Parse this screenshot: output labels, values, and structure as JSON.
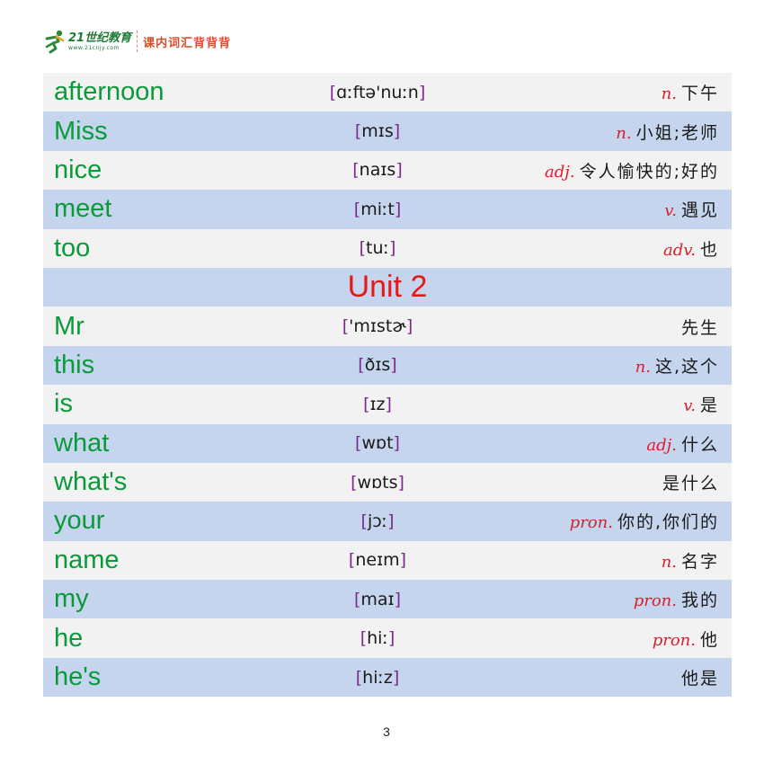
{
  "header": {
    "logo_brand": "21世纪教育",
    "logo_url": "www.21cnjy.com",
    "title": "课内词汇背背背"
  },
  "rows": [
    {
      "type": "word",
      "word": "afternoon",
      "phonetic": "ɑːftə'nuːn",
      "pos": "n.",
      "meaning": "下午"
    },
    {
      "type": "word",
      "word": "Miss",
      "phonetic": "mɪs",
      "pos": "n.",
      "meaning": "小姐;老师"
    },
    {
      "type": "word",
      "word": "nice",
      "phonetic": "naɪs",
      "pos": "adj.",
      "meaning": "令人愉快的;好的"
    },
    {
      "type": "word",
      "word": "meet",
      "phonetic": "miːt",
      "pos": "v.",
      "meaning": "遇见"
    },
    {
      "type": "word",
      "word": "too",
      "phonetic": "tuː",
      "pos": "adv.",
      "meaning": "也"
    },
    {
      "type": "unit",
      "label": "Unit 2"
    },
    {
      "type": "word",
      "word": "Mr",
      "phonetic": "'mɪstɚ",
      "pos": "",
      "meaning": "先生"
    },
    {
      "type": "word",
      "word": "this",
      "phonetic": "ðɪs",
      "pos": "n.",
      "meaning": "这,这个"
    },
    {
      "type": "word",
      "word": "is",
      "phonetic": "ɪz",
      "pos": "v.",
      "meaning": "是"
    },
    {
      "type": "word",
      "word": "what",
      "phonetic": "wɒt",
      "pos": "adj.",
      "meaning": "什么"
    },
    {
      "type": "word",
      "word": "what's",
      "phonetic": "wɒts",
      "pos": "",
      "meaning": "是什么"
    },
    {
      "type": "word",
      "word": "your",
      "phonetic": "jɔː",
      "pos": "pron.",
      "meaning": "你的,你们的"
    },
    {
      "type": "word",
      "word": "name",
      "phonetic": "neɪm",
      "pos": "n.",
      "meaning": "名字"
    },
    {
      "type": "word",
      "word": "my",
      "phonetic": "maɪ",
      "pos": "pron.",
      "meaning": "我的"
    },
    {
      "type": "word",
      "word": "he",
      "phonetic": "hiː",
      "pos": "pron.",
      "meaning": "他"
    },
    {
      "type": "word",
      "word": "he's",
      "phonetic": "hiːz",
      "pos": "",
      "meaning": "他是"
    }
  ],
  "page_number": "3"
}
